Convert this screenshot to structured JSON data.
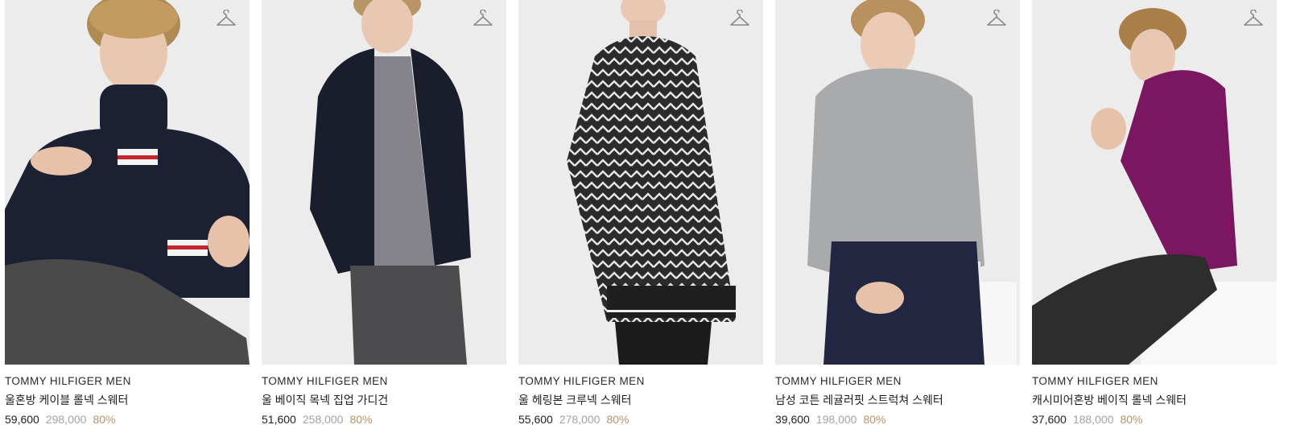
{
  "products": [
    {
      "brand": "TOMMY HILFIGER MEN",
      "name": "울혼방 케이블 롤넥 스웨터",
      "price": "59,600",
      "original_price": "298,000",
      "discount": "80%",
      "garment_color": "#1c2033"
    },
    {
      "brand": "TOMMY HILFIGER MEN",
      "name": "울 베이직 목넥 집업 가디건",
      "price": "51,600",
      "original_price": "258,000",
      "discount": "80%",
      "garment_color": "#1a1d2b"
    },
    {
      "brand": "TOMMY HILFIGER MEN",
      "name": "울 헤링본 크루넥 스웨터",
      "price": "55,600",
      "original_price": "278,000",
      "discount": "80%",
      "garment_color": "#2b2b2b"
    },
    {
      "brand": "TOMMY HILFIGER MEN",
      "name": "남성 코튼 레귤러핏 스트럭쳐 스웨터",
      "price": "39,600",
      "original_price": "198,000",
      "discount": "80%",
      "garment_color": "#a9aaac"
    },
    {
      "brand": "TOMMY HILFIGER MEN",
      "name": "캐시미어혼방 베이직 롤넥 스웨터",
      "price": "37,600",
      "original_price": "188,000",
      "discount": "80%",
      "garment_color": "#7b1760"
    }
  ],
  "icons": {
    "wishlist": "hanger-icon"
  },
  "colors": {
    "price": "#222222",
    "original_price": "#a3a3a3",
    "discount": "#b8926a",
    "photo_bg": "#ececed"
  }
}
